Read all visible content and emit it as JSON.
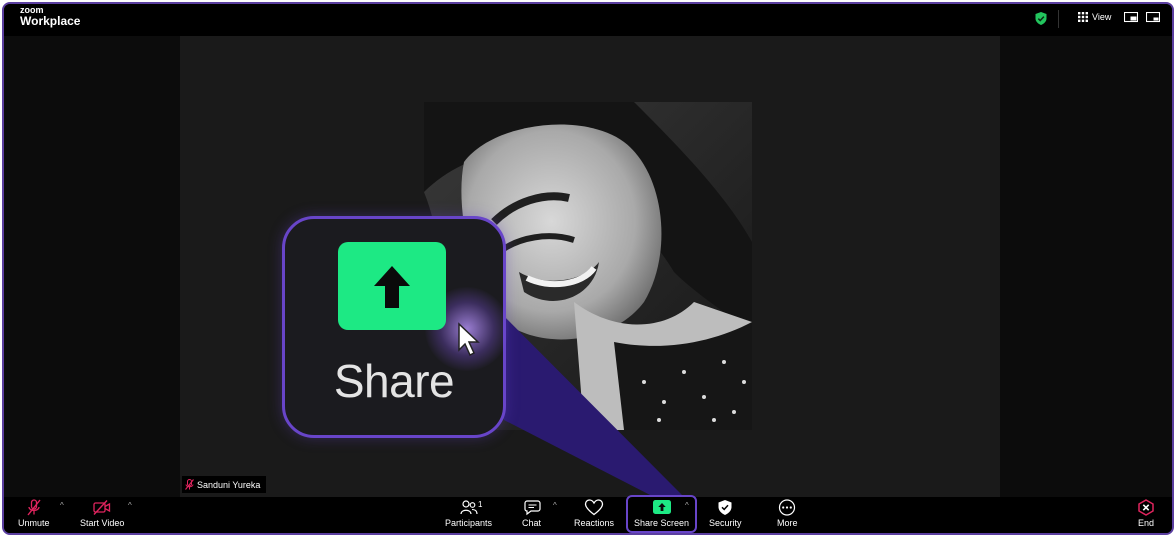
{
  "app": {
    "brand_small": "zoom",
    "brand_title": "Workplace"
  },
  "titlebar": {
    "view_label": "View",
    "view_icon": "grid-icon",
    "security_status_icon": "shield-check-icon",
    "security_color": "#22c55e"
  },
  "participant": {
    "name": "Sanduni Yureka",
    "muted": true,
    "muted_icon": "mic-off-icon"
  },
  "callout": {
    "label": "Share",
    "icon": "arrow-up-icon",
    "button_color": "#1de984",
    "border_color": "#6845c9"
  },
  "toolbar": {
    "unmute": {
      "label": "Unmute",
      "icon": "mic-off-icon"
    },
    "start_video": {
      "label": "Start Video",
      "icon": "video-off-icon"
    },
    "participants": {
      "label": "Participants",
      "count": "1",
      "icon": "participants-icon"
    },
    "chat": {
      "label": "Chat",
      "icon": "chat-icon"
    },
    "reactions": {
      "label": "Reactions",
      "icon": "heart-icon"
    },
    "share_screen": {
      "label": "Share Screen",
      "icon": "share-screen-icon",
      "color": "#1de984"
    },
    "security": {
      "label": "Security",
      "icon": "shield-icon"
    },
    "more": {
      "label": "More",
      "icon": "more-icon"
    },
    "end": {
      "label": "End",
      "icon": "end-call-icon",
      "color": "#e0245e"
    },
    "caret": "^"
  }
}
